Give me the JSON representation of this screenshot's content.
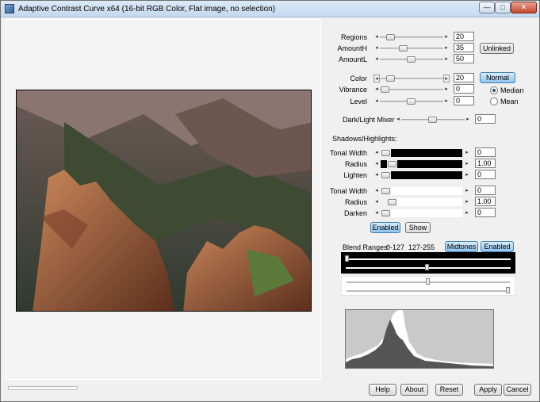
{
  "window": {
    "title": "Adaptive Contrast Curve x64 (16-bit RGB Color, Flat image, no selection)"
  },
  "titlebar": {
    "min": "—",
    "max": "□",
    "close": "✕"
  },
  "controls": {
    "regions": {
      "label": "Regions",
      "value": "20",
      "pos": 0.12
    },
    "amount_h": {
      "label": "AmountH",
      "value": "35",
      "pos": 0.35
    },
    "amount_l": {
      "label": "AmountL",
      "value": "50",
      "pos": 0.5
    },
    "unlinked_label": "Unlinked",
    "color": {
      "label": "Color",
      "value": "20",
      "pos": 0.12
    },
    "normal_label": "Normal",
    "vibrance": {
      "label": "Vibrance",
      "value": "0",
      "pos": 0.0
    },
    "level": {
      "label": "Level",
      "value": "0",
      "pos": 0.5
    },
    "median_label": "Median",
    "mean_label": "Mean",
    "dark_light_mixer": {
      "label": "Dark/Light Mixer",
      "value": "0",
      "pos": 0.5
    }
  },
  "shadows_highlights": {
    "heading": "Shadows/Highlights:",
    "s_tonal_width": {
      "label": "Tonal Width",
      "value": "0"
    },
    "s_radius": {
      "label": "Radius",
      "value": "1.00"
    },
    "s_lighten": {
      "label": "Lighten",
      "value": "0"
    },
    "h_tonal_width": {
      "label": "Tonal Width",
      "value": "0"
    },
    "h_radius": {
      "label": "Radius",
      "value": "1.00"
    },
    "h_darken": {
      "label": "Darken",
      "value": "0"
    },
    "enabled_label": "Enabled",
    "show_label": "Show"
  },
  "blend": {
    "label": "Blend Ranges:",
    "ranges": "0-127  127-255",
    "midtones_label": "Midtones",
    "enabled_label": "Enabled"
  },
  "footer": {
    "help": "Help",
    "about": "About",
    "reset": "Reset",
    "apply": "Apply",
    "cancel": "Cancel"
  },
  "colors": {
    "accent": "#8fc3ef",
    "window_bg": "#f0f0f0"
  }
}
